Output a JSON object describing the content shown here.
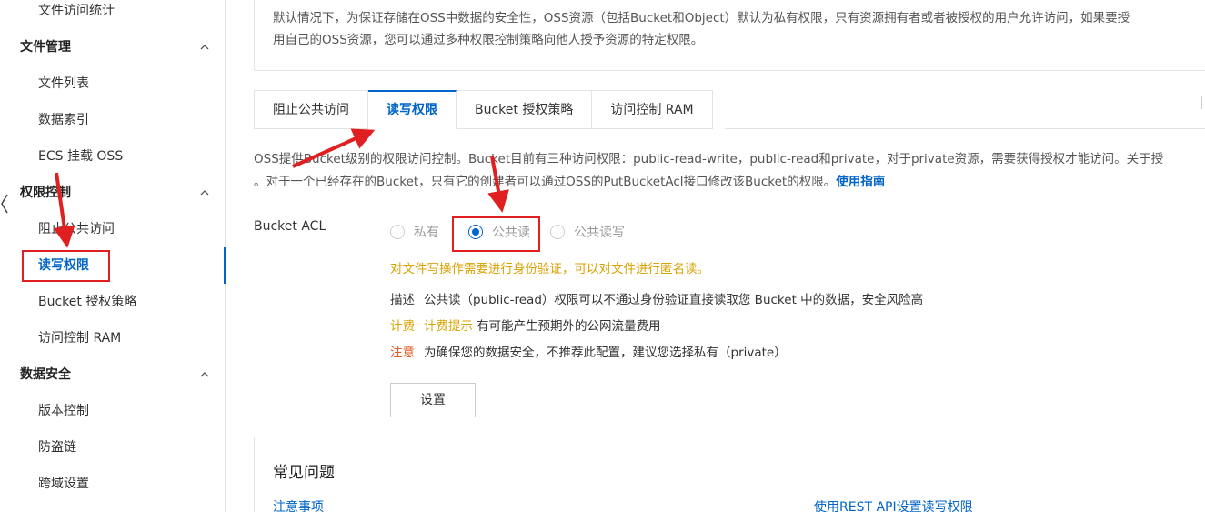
{
  "sidebar": {
    "items_top": [
      {
        "label": "文件访问统计"
      }
    ],
    "groups": [
      {
        "label": "文件管理",
        "items": [
          "文件列表",
          "数据索引",
          "ECS 挂载 OSS"
        ]
      },
      {
        "label": "权限控制",
        "items": [
          "阻止公共访问",
          "读写权限",
          "Bucket 授权策略",
          "访问控制 RAM"
        ]
      },
      {
        "label": "数据安全",
        "items": [
          "版本控制",
          "防盗链",
          "跨域设置"
        ]
      }
    ],
    "active_item": "读写权限"
  },
  "notice": {
    "line1": "默认情况下，为保证存储在OSS中数据的安全性，OSS资源（包括Bucket和Object）默认为私有权限，只有资源拥有者或者被授权的用户允许访问，如果要授",
    "line2": "用自己的OSS资源，您可以通过多种权限控制策略向他人授予资源的特定权限。"
  },
  "tabs": [
    {
      "label": "阻止公共访问",
      "active": false
    },
    {
      "label": "读写权限",
      "active": true
    },
    {
      "label": "Bucket 授权策略",
      "active": false
    },
    {
      "label": "访问控制 RAM",
      "active": false
    }
  ],
  "description": {
    "line1": "OSS提供Bucket级别的权限访问控制。Bucket目前有三种访问权限：public-read-write，public-read和private，对于private资源，需要获得授权才能访问。关于授",
    "line2": "。对于一个已经存在的Bucket，只有它的创建者可以通过OSS的PutBucketAcl接口修改该Bucket的权限。",
    "link": "使用指南"
  },
  "acl": {
    "label": "Bucket ACL",
    "options": [
      {
        "label": "私有",
        "checked": false
      },
      {
        "label": "公共读",
        "checked": true
      },
      {
        "label": "公共读写",
        "checked": false
      }
    ],
    "warning": "对文件写操作需要进行身份验证，可以对文件进行匿名读。",
    "desc_key": "描述",
    "desc_value": "公共读（public-read）权限可以不通过身份验证直接读取您 Bucket 中的数据，安全风险高",
    "billing_key": "计费",
    "billing_sub": "计费提示",
    "billing_value": "有可能产生预期外的公网流量费用",
    "note_key": "注意",
    "note_value": "为确保您的数据安全，不推荐此配置，建议您选择私有（private）",
    "button": "设置"
  },
  "faq": {
    "title": "常见问题",
    "link1": "注意事项",
    "link2": "使用REST API设置读写权限"
  },
  "colors": {
    "accent": "#0064c8",
    "warning": "#d9a200",
    "danger": "#e2571e",
    "annotation": "#e02020"
  }
}
